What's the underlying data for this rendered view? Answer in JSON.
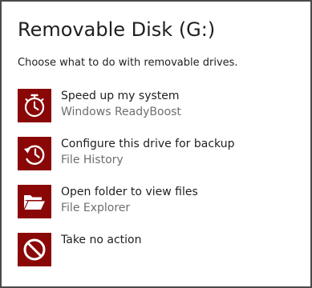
{
  "dialog": {
    "title": "Removable Disk (G:)",
    "prompt": "Choose what to do with removable drives.",
    "accent_color": "#8a0707",
    "options": [
      {
        "title": "Speed up my system",
        "subtitle": "Windows ReadyBoost",
        "icon": "stopwatch-icon"
      },
      {
        "title": "Configure this drive for backup",
        "subtitle": "File History",
        "icon": "history-icon"
      },
      {
        "title": "Open folder to view files",
        "subtitle": "File Explorer",
        "icon": "open-folder-icon"
      },
      {
        "title": "Take no action",
        "subtitle": "",
        "icon": "no-action-icon"
      }
    ]
  }
}
